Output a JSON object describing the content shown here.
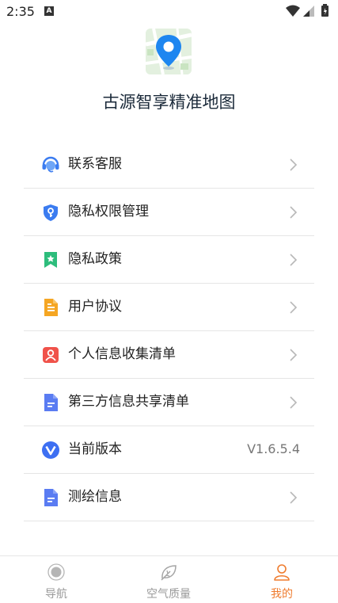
{
  "status_bar": {
    "time": "2:35",
    "notification_letter": "A"
  },
  "app": {
    "name": "古源智享精准地图"
  },
  "menu": {
    "items": [
      {
        "label": "联系客服",
        "icon": "customer-service-icon",
        "type": "chevron"
      },
      {
        "label": "隐私权限管理",
        "icon": "privacy-shield-icon",
        "type": "chevron"
      },
      {
        "label": "隐私政策",
        "icon": "bookmark-icon",
        "type": "chevron"
      },
      {
        "label": "用户协议",
        "icon": "document-icon",
        "type": "chevron"
      },
      {
        "label": "个人信息收集清单",
        "icon": "person-card-icon",
        "type": "chevron"
      },
      {
        "label": "第三方信息共享清单",
        "icon": "file-list-icon",
        "type": "chevron"
      },
      {
        "label": "当前版本",
        "icon": "version-v-icon",
        "type": "value",
        "value": "V1.6.5.4"
      },
      {
        "label": "测绘信息",
        "icon": "file-list-icon",
        "type": "chevron"
      }
    ]
  },
  "bottom_nav": {
    "items": [
      {
        "label": "导航",
        "icon": "navigation-dot-icon",
        "active": false
      },
      {
        "label": "空气质量",
        "icon": "leaf-icon",
        "active": false
      },
      {
        "label": "我的",
        "icon": "user-icon",
        "active": true
      }
    ]
  },
  "colors": {
    "accent": "#ef7c2f",
    "nav_inactive": "#9a9a9a",
    "divider": "#e5e5e5"
  }
}
